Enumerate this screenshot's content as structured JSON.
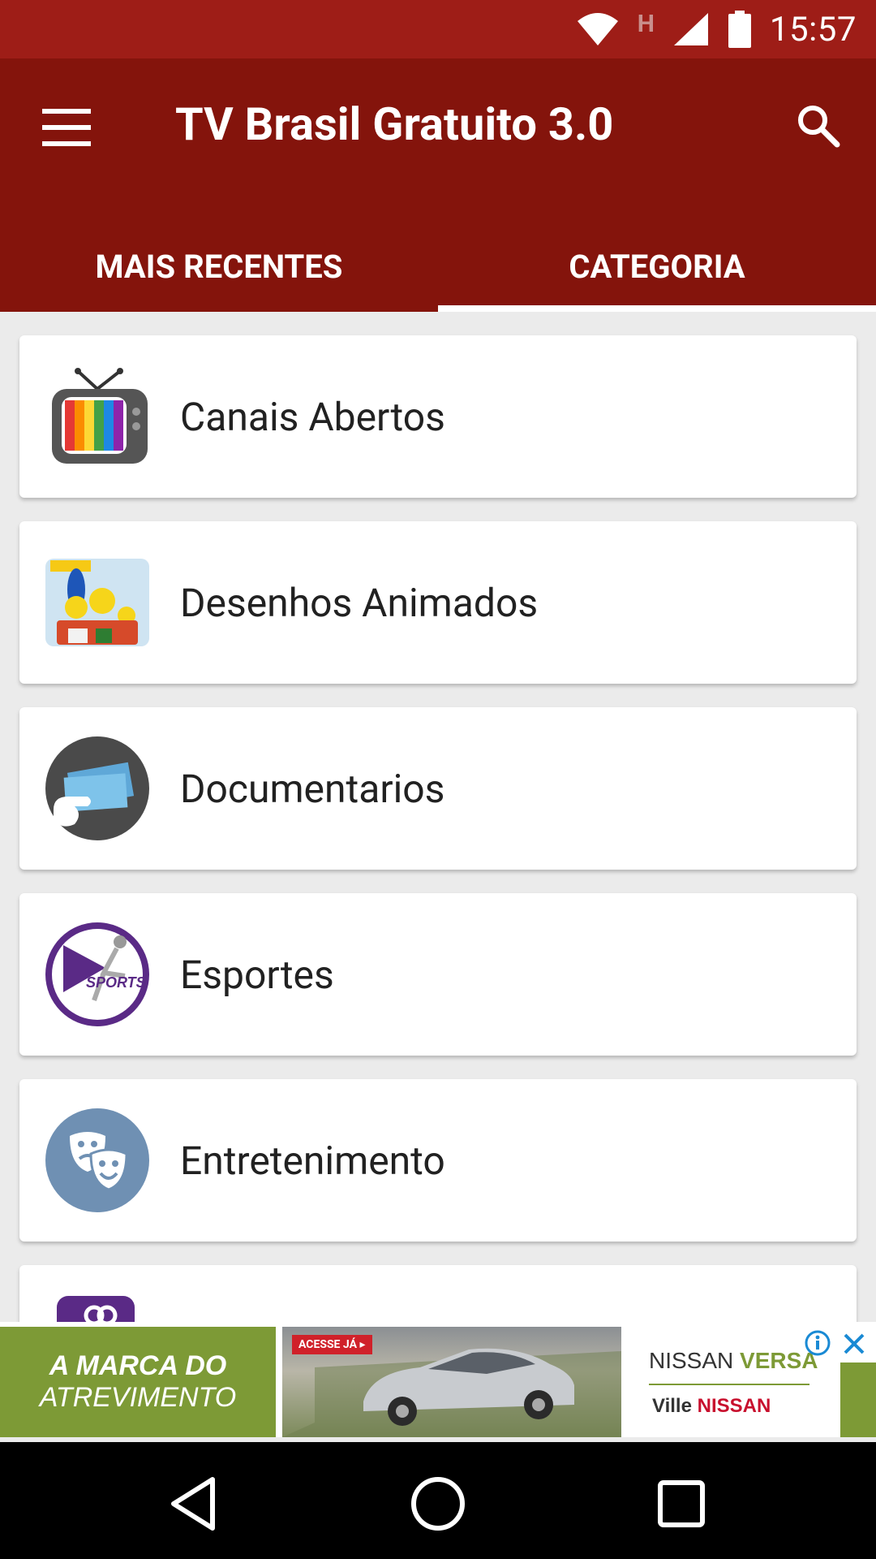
{
  "status_bar": {
    "time": "15:57",
    "network_indicator": "H",
    "icons": [
      "wifi-icon",
      "cell-signal-icon",
      "battery-icon"
    ]
  },
  "app_bar": {
    "title": "TV Brasil Gratuito 3.0",
    "menu_icon": "hamburger-menu-icon",
    "search_icon": "search-icon",
    "background": "#84140c"
  },
  "tabs": [
    {
      "label": "MAIS RECENTES",
      "active": false
    },
    {
      "label": "CATEGORIA",
      "active": true
    }
  ],
  "categories": [
    {
      "label": "Canais Abertos",
      "icon": "retro-tv-icon"
    },
    {
      "label": "Desenhos Animados",
      "icon": "cartoon-family-icon"
    },
    {
      "label": "Documentarios",
      "icon": "film-tickets-icon"
    },
    {
      "label": "Esportes",
      "icon": "sports-play-icon"
    },
    {
      "label": "Entretenimento",
      "icon": "theater-masks-icon"
    },
    {
      "label": "",
      "icon": "partial-category-icon"
    }
  ],
  "ad": {
    "left_line1": "A MARCA DO",
    "left_line2": "ATREVIMENTO",
    "cta": "ACESSE JÁ ▸",
    "brand_prefix": "NISSAN",
    "brand_model": "VERSA",
    "dealer_prefix": "Ville",
    "dealer_name": "NISSAN"
  },
  "nav_bar": {
    "buttons": [
      "back-icon",
      "home-icon",
      "recents-icon"
    ]
  }
}
